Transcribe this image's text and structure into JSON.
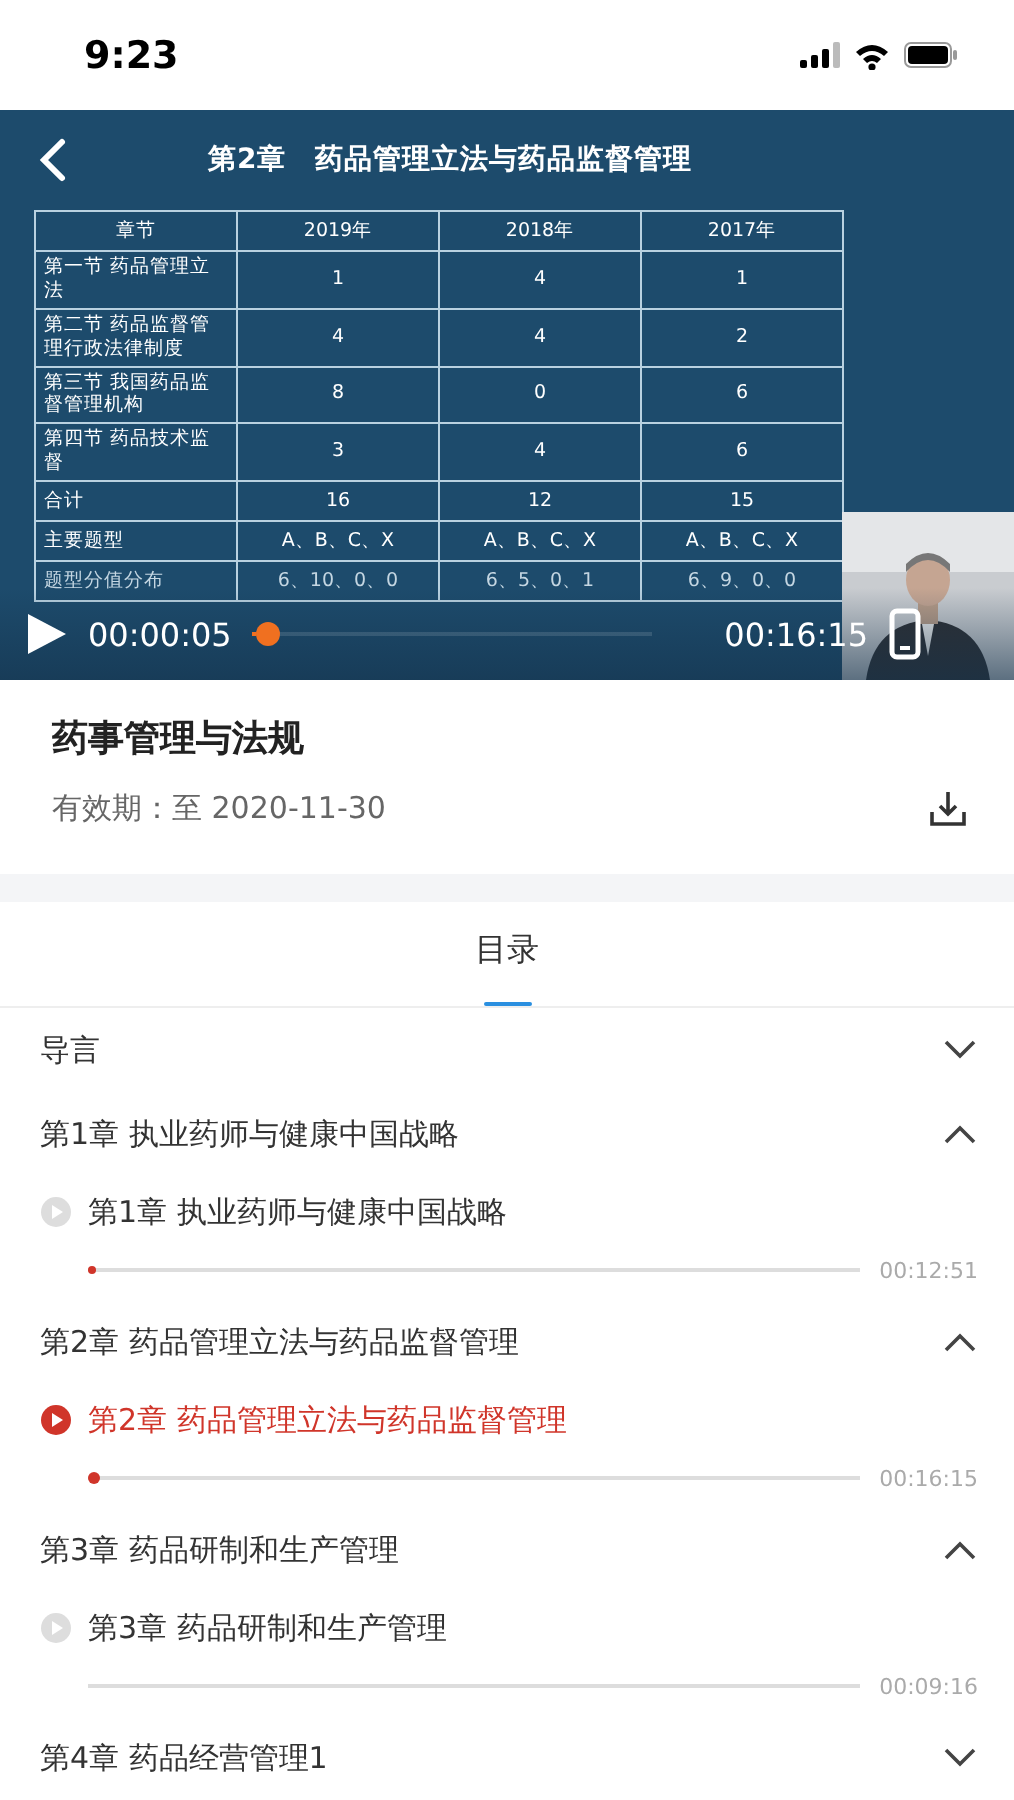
{
  "status_bar": {
    "time": "9:23"
  },
  "video": {
    "slide_title": "第2章　药品管理立法与药品监督管理",
    "table": {
      "columns": [
        "章节",
        "2019年",
        "2018年",
        "2017年"
      ],
      "rows": [
        [
          "第一节  药品管理立法",
          "1",
          "4",
          "1"
        ],
        [
          "第二节  药品监督管理行政法律制度",
          "4",
          "4",
          "2"
        ],
        [
          "第三节  我国药品监督管理机构",
          "8",
          "0",
          "6"
        ],
        [
          "第四节  药品技术监督",
          "3",
          "4",
          "6"
        ],
        [
          "合计",
          "16",
          "12",
          "15"
        ],
        [
          "主要题型",
          "A、B、C、X",
          "A、B、C、X",
          "A、B、C、X"
        ],
        [
          "题型分值分布",
          "6、10、0、0",
          "6、5、0、1",
          "6、9、0、0"
        ]
      ]
    },
    "playing": false,
    "current_time": "00:00:05",
    "duration": "00:16:15",
    "level": 0.01
  },
  "course": {
    "title": "药事管理与法规",
    "validity": "有效期：至 2020-11-30"
  },
  "tabs": [
    {
      "label": "目录",
      "selected": true
    }
  ],
  "chapters": [
    {
      "title": "导言",
      "expanded": false
    },
    {
      "title": "第1章 执业药师与健康中国战略",
      "expanded": true,
      "lessons": [
        {
          "title": "第1章 执业药师与健康中国战略",
          "selected": false,
          "level": 0.01,
          "duration": "00:12:51"
        }
      ]
    },
    {
      "title": "第2章 药品管理立法与药品监督管理",
      "expanded": true,
      "lessons": [
        {
          "title": "第2章 药品管理立法与药品监督管理",
          "selected": true,
          "level": 0.005,
          "duration": "00:16:15"
        }
      ]
    },
    {
      "title": "第3章 药品研制和生产管理",
      "expanded": true,
      "lessons": [
        {
          "title": "第3章 药品研制和生产管理",
          "selected": false,
          "level": 0,
          "duration": "00:09:16"
        }
      ]
    },
    {
      "title": "第4章 药品经营管理1",
      "expanded": false
    }
  ]
}
